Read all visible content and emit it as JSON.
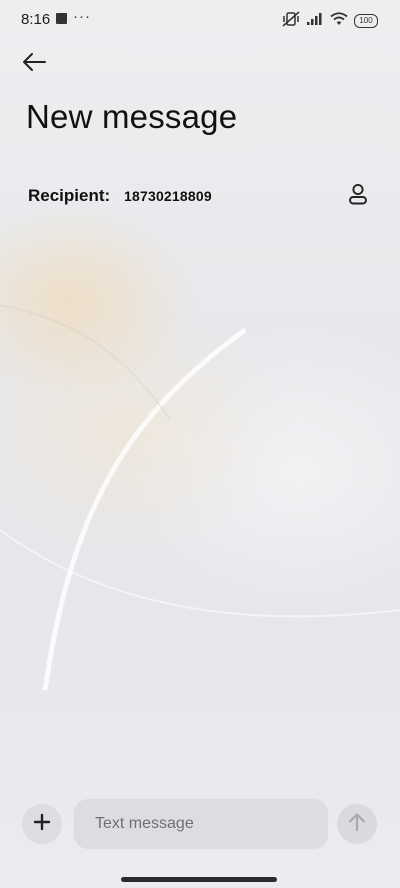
{
  "status_bar": {
    "time": "8:16",
    "more_indicator": "···",
    "battery_level": "100",
    "icons": [
      "app-notification-icon",
      "vibrate-off-icon",
      "signal-icon",
      "wifi-icon",
      "battery-icon"
    ]
  },
  "header": {
    "back_icon": "arrow-left-icon",
    "title": "New message"
  },
  "recipient": {
    "label": "Recipient:",
    "value": "18730218809",
    "contact_icon": "contact-person-icon"
  },
  "compose": {
    "add_icon": "plus-icon",
    "placeholder": "Text message",
    "value": "",
    "send_icon": "arrow-up-icon"
  }
}
